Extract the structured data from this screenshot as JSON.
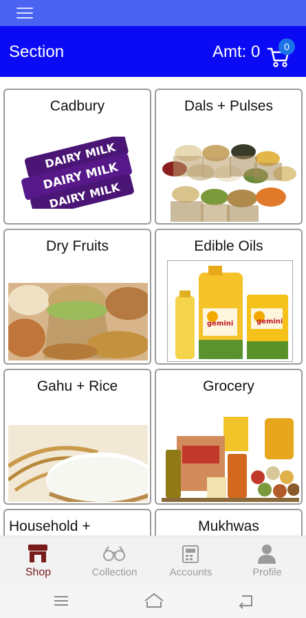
{
  "header": {
    "title": "Section",
    "amount_label": "Amt: 0",
    "cart_count": "0"
  },
  "categories": [
    {
      "label": "Cadbury",
      "icon": "cadbury-image"
    },
    {
      "label": "Dals + Pulses",
      "icon": "pulses-image"
    },
    {
      "label": "Dry Fruits",
      "icon": "dry-fruits-image"
    },
    {
      "label": "Edible Oils",
      "icon": "edible-oils-image"
    },
    {
      "label": "Gahu + Rice",
      "icon": "rice-image"
    },
    {
      "label": "Grocery",
      "icon": "grocery-image"
    },
    {
      "label": "Household +",
      "icon": ""
    },
    {
      "label": "Mukhwas",
      "icon": ""
    }
  ],
  "bottom_nav": [
    {
      "label": "Shop",
      "icon": "shop-icon",
      "active": true
    },
    {
      "label": "Collection",
      "icon": "glasses-icon",
      "active": false
    },
    {
      "label": "Accounts",
      "icon": "accounts-icon",
      "active": false
    },
    {
      "label": "Profile",
      "icon": "profile-icon",
      "active": false
    }
  ],
  "colors": {
    "status_bar": "#4a63f0",
    "app_bar": "#0a0af5",
    "badge": "#1a73e8",
    "active_nav": "#7a1b1b"
  }
}
